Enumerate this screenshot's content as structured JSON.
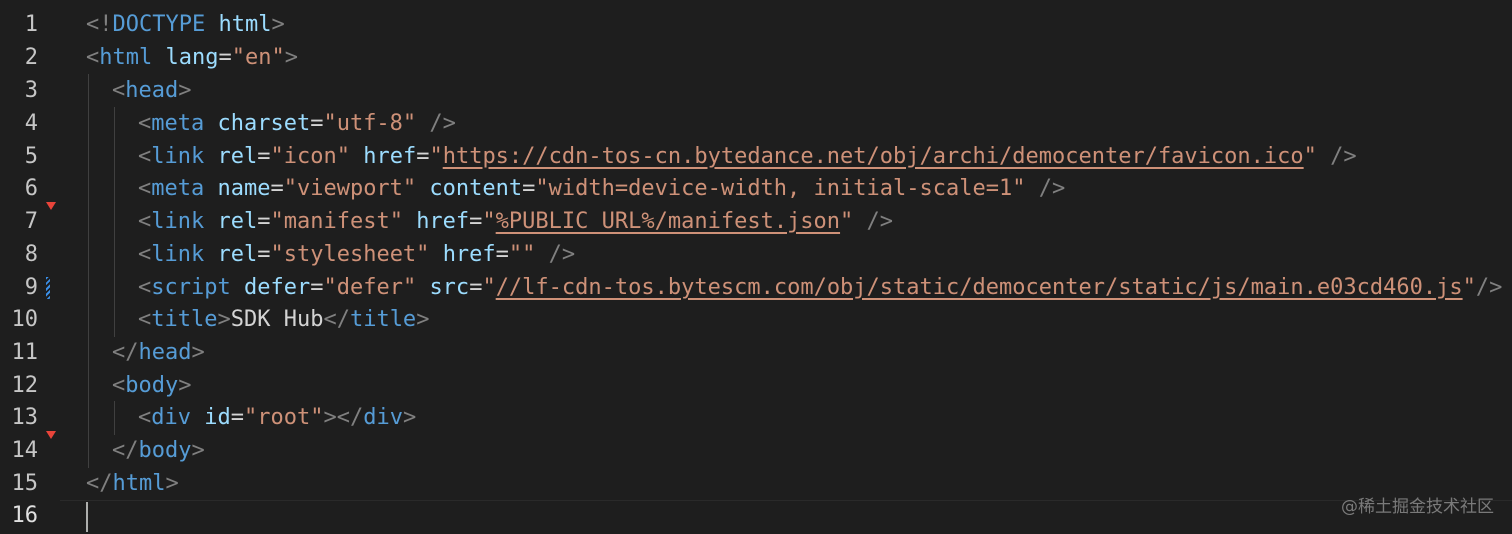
{
  "editor": {
    "language": "html",
    "active_line": "16",
    "line_numbers": [
      "1",
      "2",
      "3",
      "4",
      "5",
      "6",
      "7",
      "8",
      "9",
      "10",
      "11",
      "12",
      "13",
      "14",
      "15",
      "16"
    ],
    "colors": {
      "background": "#1e1e1e",
      "tag": "#569cd6",
      "attribute": "#9cdcfe",
      "string": "#ce9178",
      "bracket": "#808080",
      "error_marker": "#e8443a",
      "modified_marker": "#3a8ee6"
    },
    "gutter_markers": [
      {
        "line": "7",
        "kind": "error-triangle"
      },
      {
        "line": "9",
        "kind": "modified"
      },
      {
        "line": "14",
        "kind": "error-triangle"
      }
    ]
  },
  "code": {
    "l1": {
      "o": "<!",
      "tag": "DOCTYPE",
      "sp": " ",
      "name": "html",
      "c": ">"
    },
    "l2": {
      "o": "<",
      "tag": "html",
      "a1": "lang",
      "v1": "\"en\"",
      "c": ">"
    },
    "l3": {
      "o": "<",
      "tag": "head",
      "c": ">"
    },
    "l4": {
      "o": "<",
      "tag": "meta",
      "a1": "charset",
      "v1": "\"utf-8\"",
      "c": "/>"
    },
    "l5": {
      "o": "<",
      "tag": "link",
      "a1": "rel",
      "v1": "\"icon\"",
      "a2": "href",
      "q1": "\"",
      "url": "https://cdn-tos-cn.bytedance.net/obj/archi/democenter/favicon.ico",
      "q2": "\"",
      "c": "/>"
    },
    "l6": {
      "o": "<",
      "tag": "meta",
      "a1": "name",
      "v1": "\"viewport\"",
      "a2": "content",
      "v2": "\"width=device-width, initial-scale=1\"",
      "c": "/>"
    },
    "l7": {
      "o": "<",
      "tag": "link",
      "a1": "rel",
      "v1": "\"manifest\"",
      "a2": "href",
      "q1": "\"",
      "url": "%PUBLIC_URL%/manifest.json",
      "q2": "\"",
      "c": "/>"
    },
    "l8": {
      "o": "<",
      "tag": "link",
      "a1": "rel",
      "v1": "\"stylesheet\"",
      "a2": "href",
      "v2": "\"\"",
      "c": "/>"
    },
    "l9": {
      "o": "<",
      "tag": "script",
      "a1": "defer",
      "v1": "\"defer\"",
      "a2": "src",
      "q1": "\"",
      "url": "//lf-cdn-tos.bytescm.com/obj/static/democenter/static/js/main.e03cd460.js",
      "q2": "\"",
      "c": "/>"
    },
    "l10": {
      "o": "<",
      "tag": "title",
      "c1": ">",
      "text": "SDK Hub",
      "o2": "</",
      "tag2": "title",
      "c": ">"
    },
    "l11": {
      "o": "</",
      "tag": "head",
      "c": ">"
    },
    "l12": {
      "o": "<",
      "tag": "body",
      "c": ">"
    },
    "l13": {
      "o": "<",
      "tag": "div",
      "a1": "id",
      "v1": "\"root\"",
      "c1": ">",
      "o2": "</",
      "tag2": "div",
      "c": ">"
    },
    "l14": {
      "o": "</",
      "tag": "body",
      "c": ">"
    },
    "l15": {
      "o": "</",
      "tag": "html",
      "c": ">"
    }
  },
  "watermark": "@稀土掘金技术社区"
}
